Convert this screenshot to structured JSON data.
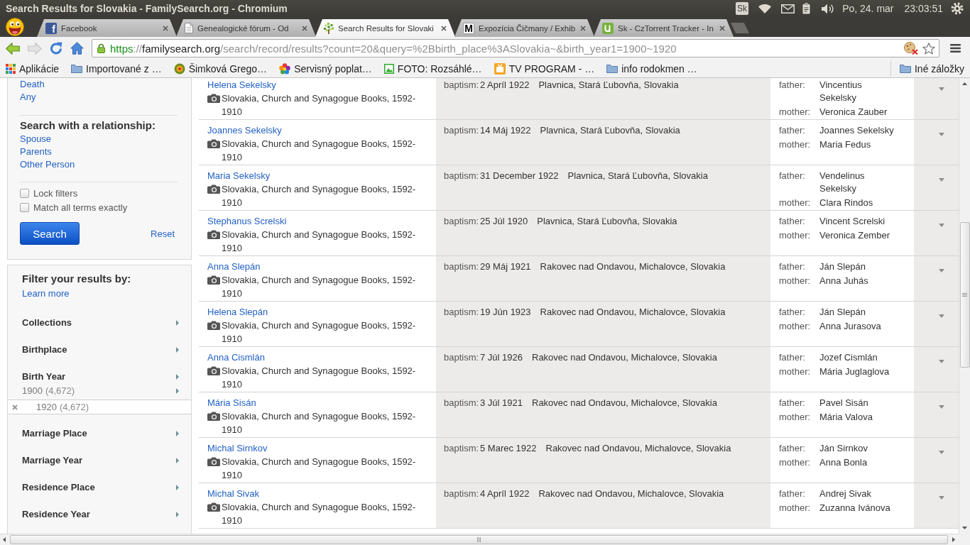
{
  "window": {
    "title": "Search Results for Slovakia - FamilySearch.org - Chromium"
  },
  "system_tray": {
    "keyboard_layout": "Sk",
    "date": "Po, 24. mar",
    "time": "23:03:51"
  },
  "tabs": [
    {
      "label": "Facebook",
      "selected": false,
      "logo_letter": "f"
    },
    {
      "label": "Genealogické fórum - Od",
      "selected": false
    },
    {
      "label": "Search Results for Slovaki",
      "selected": true
    },
    {
      "label": "Expozícia Čičmany / Exhib",
      "selected": false,
      "logo_letter": "M"
    },
    {
      "label": "Sk - CzTorrent Tracker - In",
      "selected": false
    }
  ],
  "address_bar": {
    "url": [
      {
        "kind": "scheme",
        "text": "https"
      },
      {
        "kind": "separator",
        "text": "://"
      },
      {
        "kind": "host",
        "text": "familysearch.org"
      },
      {
        "kind": "path",
        "text": "/search/record/results?count=20&query=%2Bbirth_place%3ASlovakia~&birth_year1=1900~1920"
      }
    ]
  },
  "bookmarks": [
    {
      "kind": "apps",
      "label": "Aplikácie"
    },
    {
      "kind": "folder",
      "label": "Importované z …"
    },
    {
      "kind": "site",
      "label": "Šimková Grego…"
    },
    {
      "kind": "site",
      "label": "Servisný poplat…"
    },
    {
      "kind": "site",
      "label": "FOTO: Rozsáhlé…"
    },
    {
      "kind": "site",
      "label": "TV PROGRAM - …"
    },
    {
      "kind": "folder",
      "label": "info rodokmen …"
    }
  ],
  "other_bookmarks": {
    "label": "Iné záložky"
  },
  "search_panel": {
    "event_links": [
      "Death",
      "Any"
    ],
    "relationship_heading": "Search with a relationship:",
    "relationship_links": [
      "Spouse",
      "Parents",
      "Other Person"
    ],
    "options": [
      {
        "label": "Lock filters",
        "checked": false
      },
      {
        "label": "Match all terms exactly",
        "checked": false
      }
    ],
    "search_button": "Search",
    "reset_link": "Reset"
  },
  "filter_panel": {
    "heading": "Filter your results by:",
    "learn_more": "Learn more",
    "filters": [
      {
        "label": "Collections"
      },
      {
        "label": "Birthplace"
      },
      {
        "label": "Birth Year",
        "values": [
          {
            "year": "1900",
            "count": "(4,672)",
            "selected": false
          },
          {
            "year": "1920",
            "count": "(4,672)",
            "selected": true
          }
        ]
      },
      {
        "label": "Marriage Place"
      },
      {
        "label": "Marriage Year"
      },
      {
        "label": "Residence Place"
      },
      {
        "label": "Residence Year"
      }
    ]
  },
  "results": [
    {
      "name": "Helena Sekelsky",
      "collection": "Slovakia, Church and Synagogue Books, 1592-1910",
      "event": "baptism:",
      "date": "2 Apríl 1922",
      "place": "Plavnica, Stará Ľubovňa, Slovakia",
      "relatives": [
        {
          "role": "father:",
          "name": "Vincentius Sekelsky"
        },
        {
          "role": "mother:",
          "name": "Veronica Zauber"
        }
      ]
    },
    {
      "name": "Joannes Sekelsky",
      "collection": "Slovakia, Church and Synagogue Books, 1592-1910",
      "event": "baptism:",
      "date": "14 Máj 1922",
      "place": "Plavnica, Stará Ľubovňa, Slovakia",
      "relatives": [
        {
          "role": "father:",
          "name": "Joannes Sekelsky"
        },
        {
          "role": "mother:",
          "name": "Maria Fedus"
        }
      ]
    },
    {
      "name": "Maria Sekelsky",
      "collection": "Slovakia, Church and Synagogue Books, 1592-1910",
      "event": "baptism:",
      "date": "31 December 1922",
      "place": "Plavnica, Stará Ľubovňa, Slovakia",
      "relatives": [
        {
          "role": "father:",
          "name": "Vendelinus Sekelsky"
        },
        {
          "role": "mother:",
          "name": "Clara Rindos"
        }
      ]
    },
    {
      "name": "Stephanus Screlski",
      "collection": "Slovakia, Church and Synagogue Books, 1592-1910",
      "event": "baptism:",
      "date": "25 Júl 1920",
      "place": "Plavnica, Stará Ľubovňa, Slovakia",
      "relatives": [
        {
          "role": "father:",
          "name": "Vincent Screlski"
        },
        {
          "role": "mother:",
          "name": "Veronica Zember"
        }
      ]
    },
    {
      "name": "Anna Slepán",
      "collection": "Slovakia, Church and Synagogue Books, 1592-1910",
      "event": "baptism:",
      "date": "29 Máj 1921",
      "place": "Rakovec nad Ondavou, Michalovce, Slovakia",
      "relatives": [
        {
          "role": "father:",
          "name": "Ján Slepán"
        },
        {
          "role": "mother:",
          "name": "Anna Juhás"
        }
      ]
    },
    {
      "name": "Helena Slepán",
      "collection": "Slovakia, Church and Synagogue Books, 1592-1910",
      "event": "baptism:",
      "date": "19 Jún 1923",
      "place": "Rakovec nad Ondavou, Michalovce, Slovakia",
      "relatives": [
        {
          "role": "father:",
          "name": "Ján Slepán"
        },
        {
          "role": "mother:",
          "name": "Anna Jurasova"
        }
      ]
    },
    {
      "name": "Anna Cismlán",
      "collection": "Slovakia, Church and Synagogue Books, 1592-1910",
      "event": "baptism:",
      "date": "7 Júl 1926",
      "place": "Rakovec nad Ondavou, Michalovce, Slovakia",
      "relatives": [
        {
          "role": "father:",
          "name": "Jozef Cismlán"
        },
        {
          "role": "mother:",
          "name": "Mária Juglaglova"
        }
      ]
    },
    {
      "name": "Mária Sisán",
      "collection": "Slovakia, Church and Synagogue Books, 1592-1910",
      "event": "baptism:",
      "date": "3 Júl 1921",
      "place": "Rakovec nad Ondavou, Michalovce, Slovakia",
      "relatives": [
        {
          "role": "father:",
          "name": "Pavel Sisán"
        },
        {
          "role": "mother:",
          "name": "Mária Valova"
        }
      ]
    },
    {
      "name": "Michal Sirnkov",
      "collection": "Slovakia, Church and Synagogue Books, 1592-1910",
      "event": "baptism:",
      "date": "5 Marec 1922",
      "place": "Rakovec nad Ondavou, Michalovce, Slovakia",
      "relatives": [
        {
          "role": "father:",
          "name": "Ján Sirnkov"
        },
        {
          "role": "mother:",
          "name": "Anna Bonla"
        }
      ]
    },
    {
      "name": "Michal Sivak",
      "collection": "Slovakia, Church and Synagogue Books, 1592-1910",
      "event": "baptism:",
      "date": "4 Apríl 1922",
      "place": "Rakovec nad Ondavou, Michalovce, Slovakia",
      "relatives": [
        {
          "role": "father:",
          "name": "Andrej Sivak"
        },
        {
          "role": "mother:",
          "name": "Zuzanna Ivánova"
        }
      ]
    }
  ]
}
